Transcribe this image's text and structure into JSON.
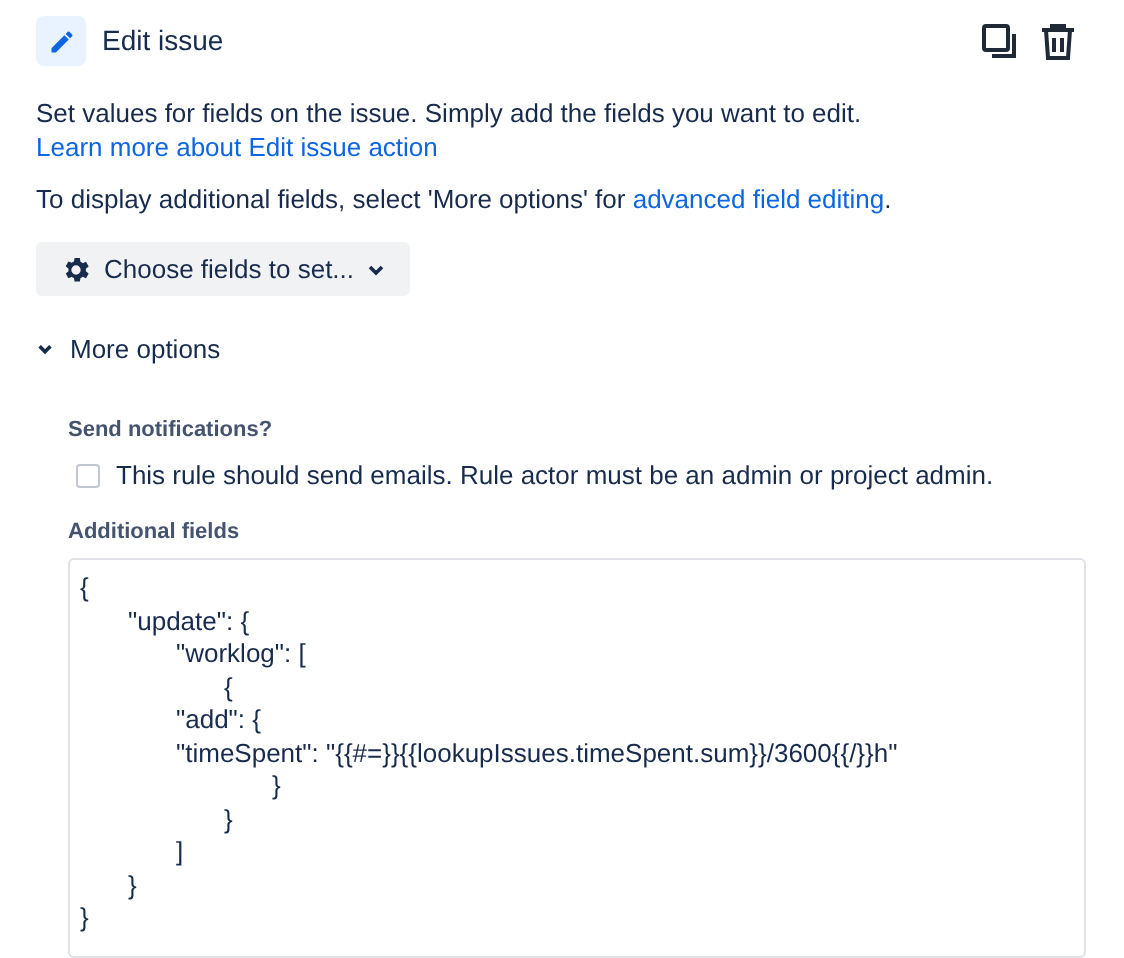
{
  "header": {
    "title": "Edit issue"
  },
  "description": {
    "text": "Set values for fields on the issue. Simply add the fields you want to edit. ",
    "link": "Learn more about Edit issue action"
  },
  "advanced_note": {
    "text": "To display additional fields, select 'More options' for ",
    "link": "advanced field editing",
    "suffix": "."
  },
  "choose_fields_button": {
    "label": "Choose fields to set..."
  },
  "more_options": {
    "label": "More options",
    "expanded": true
  },
  "send_notifications": {
    "label": "Send notifications?",
    "checkbox_label": "This rule should send emails. Rule actor must be an admin or project admin.",
    "checked": false
  },
  "additional_fields": {
    "label": "Additional fields",
    "value": "{\n\t\"update\": {\n\t\t\"worklog\": [\n\t\t\t{\n\t\t\"add\": {\n\t\t\"timeSpent\": \"{{#=}}{{lookupIssues.timeSpent.sum}}/3600{{/}}h\"\n\t\t\t\t}\n\t\t\t}\n\t\t]\n\t}\n}"
  }
}
